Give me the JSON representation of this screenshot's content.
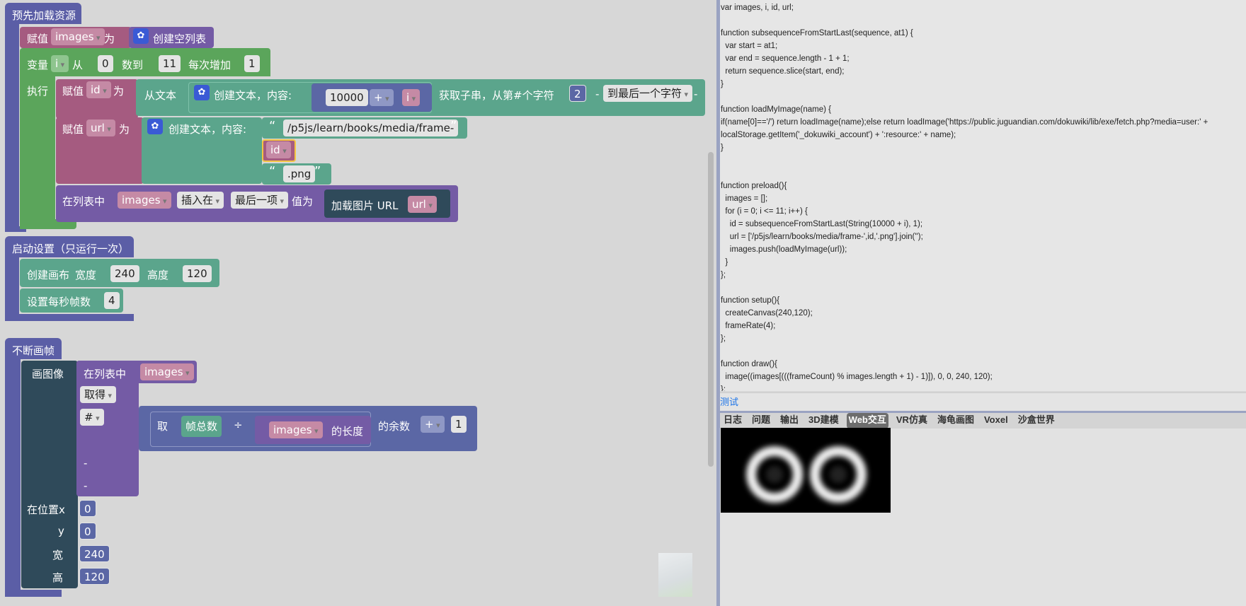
{
  "blocks": {
    "preload": {
      "hat": "预先加载资源",
      "assign1": {
        "set": "赋值",
        "var": "images",
        "as": "为",
        "value": "创建空列表"
      },
      "loop": {
        "label": "变量",
        "var": "i",
        "from_label": "从",
        "from": "0",
        "to_label": "数到",
        "to": "11",
        "step_label": "每次增加",
        "step": "1",
        "do": "执行"
      },
      "assign_id": {
        "set": "赋值",
        "var": "id",
        "as": "为",
        "from_text": "从文本",
        "create_text": "创建文本，内容:",
        "num": "10000",
        "op": "+",
        "ivar": "i",
        "substring": "获取子串，从第#个字符",
        "start": "2",
        "dash1": "-",
        "to_end": "到最后一个字符",
        "dash2": "-"
      },
      "assign_url": {
        "set": "赋值",
        "var": "url",
        "as": "为",
        "create_text": "创建文本，内容:",
        "lq": "“",
        "rq": "”",
        "part1": "/p5js/learn/books/media/frame-",
        "part2": "id",
        "part3": ".png"
      },
      "insert": {
        "in_list": "在列表中",
        "list": "images",
        "mode": "插入在",
        "where": "最后一项",
        "value_label": "值为",
        "load": "加载图片 URL",
        "url": "url"
      }
    },
    "setup": {
      "hat": "启动设置（只运行一次）",
      "canvas": {
        "label": "创建画布",
        "w_label": "宽度",
        "w": "240",
        "h_label": "高度",
        "h": "120"
      },
      "fps": {
        "label": "设置每秒帧数",
        "value": "4"
      }
    },
    "draw": {
      "hat": "不断画帧",
      "image": {
        "label": "画图像",
        "in_list": "在列表中",
        "list": "images",
        "get": "取得",
        "hash": "#",
        "mod_take": "取",
        "frame_count": "帧总数",
        "div": "÷",
        "list2": "images",
        "length": "的长度",
        "remainder": "的余数",
        "plus": "+",
        "one": "1",
        "dash1": "-",
        "dash2": "-",
        "x_label": "在位置x",
        "x": "0",
        "y_label": "y",
        "y": "0",
        "w_label": "宽",
        "w": "240",
        "h_label": "高",
        "h": "120"
      }
    }
  },
  "code_lines": [
    "var images, i, id, url;",
    "",
    "function subsequenceFromStartLast(sequence, at1) {",
    "  var start = at1;",
    "  var end = sequence.length - 1 + 1;",
    "  return sequence.slice(start, end);",
    "}",
    "",
    "function loadMyImage(name) {",
    "if(name[0]=='/') return loadImage(name);else return loadImage('https://public.juguandian.com/dokuwiki/lib/exe/fetch.php?media=user:' +",
    "localStorage.getItem('_dokuwiki_account') + ':resource:' + name);",
    "}",
    "",
    "",
    "function preload(){",
    "  images = [];",
    "  for (i = 0; i <= 11; i++) {",
    "    id = subsequenceFromStartLast(String(10000 + i), 1);",
    "    url = ['/p5js/learn/books/media/frame-',id,'.png'].join('');",
    "    images.push(loadMyImage(url));",
    "  }",
    "};",
    "",
    "function setup(){",
    "  createCanvas(240,120);",
    "  frameRate(4);",
    "};",
    "",
    "function draw(){",
    "  image((images[(((frameCount) % images.length + 1) - 1)]), 0, 0, 240, 120);",
    "};"
  ],
  "test_link": "测试",
  "tabs": [
    {
      "label": "日志",
      "active": false
    },
    {
      "label": "问题",
      "active": false
    },
    {
      "label": "输出",
      "active": false
    },
    {
      "label": "3D建模",
      "active": false
    },
    {
      "label": "Web交互",
      "active": true
    },
    {
      "label": "VR仿真",
      "active": false
    },
    {
      "label": "海龟画图",
      "active": false
    },
    {
      "label": "Voxel",
      "active": false
    },
    {
      "label": "沙盒世界",
      "active": false
    }
  ],
  "colors": {
    "hat": "#5b5ea6",
    "variable": "#a55b80",
    "loop": "#5ba55b",
    "text": "#5ba58c",
    "list": "#745ba5",
    "math": "#5b67a5",
    "draw": "#2f4a5a"
  },
  "icons": {
    "gear": "gear-icon"
  }
}
